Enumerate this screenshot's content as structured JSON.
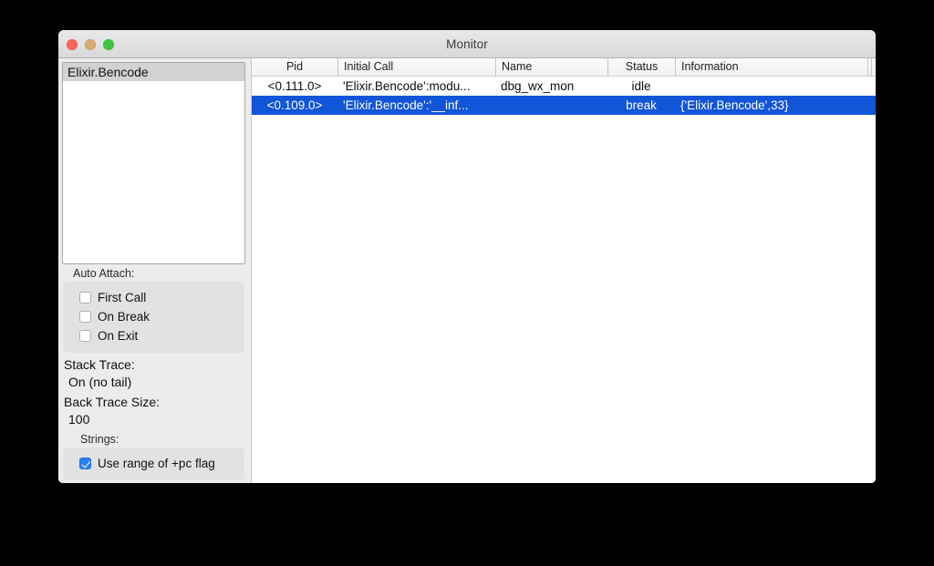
{
  "window": {
    "title": "Monitor",
    "traffic_lights": [
      {
        "name": "close",
        "color": "#f9655b"
      },
      {
        "name": "minimize",
        "color": "#d9ab71"
      },
      {
        "name": "maximize",
        "color": "#3cc93f"
      }
    ]
  },
  "sidebar": {
    "module_list": {
      "items": [
        {
          "label": "Elixir.Bencode",
          "selected": true
        }
      ]
    },
    "auto_attach": {
      "label": "Auto Attach:",
      "options": [
        {
          "label": "First Call",
          "checked": false
        },
        {
          "label": "On Break",
          "checked": false
        },
        {
          "label": "On Exit",
          "checked": false
        }
      ]
    },
    "stack_trace": {
      "label": "Stack Trace:",
      "value": "On (no tail)"
    },
    "back_trace_size": {
      "label": "Back Trace Size:",
      "value": "100"
    },
    "strings": {
      "label": "Strings:",
      "options": [
        {
          "label": "Use range of +pc flag",
          "checked": true
        }
      ]
    }
  },
  "process_table": {
    "columns": [
      {
        "key": "pid",
        "label": "Pid",
        "align": "center"
      },
      {
        "key": "initialcall",
        "label": "Initial Call",
        "align": "left"
      },
      {
        "key": "name",
        "label": "Name",
        "align": "left"
      },
      {
        "key": "status",
        "label": "Status",
        "align": "center"
      },
      {
        "key": "information",
        "label": "Information",
        "align": "left"
      }
    ],
    "rows": [
      {
        "pid": "<0.111.0>",
        "initialcall": "'Elixir.Bencode':modu...",
        "name": "dbg_wx_mon",
        "status": "idle",
        "information": "",
        "selected": false
      },
      {
        "pid": "<0.109.0>",
        "initialcall": "'Elixir.Bencode':'__inf...",
        "name": "",
        "status": "break",
        "information": "{'Elixir.Bencode',33}",
        "selected": true
      }
    ]
  },
  "colors": {
    "selection_blue": "#1155d8",
    "inactive_selection": "#d2d2d2",
    "checkbox_blue": "#2b7ef4",
    "window_chrome": "#ececec",
    "desktop_background": "#000000"
  }
}
